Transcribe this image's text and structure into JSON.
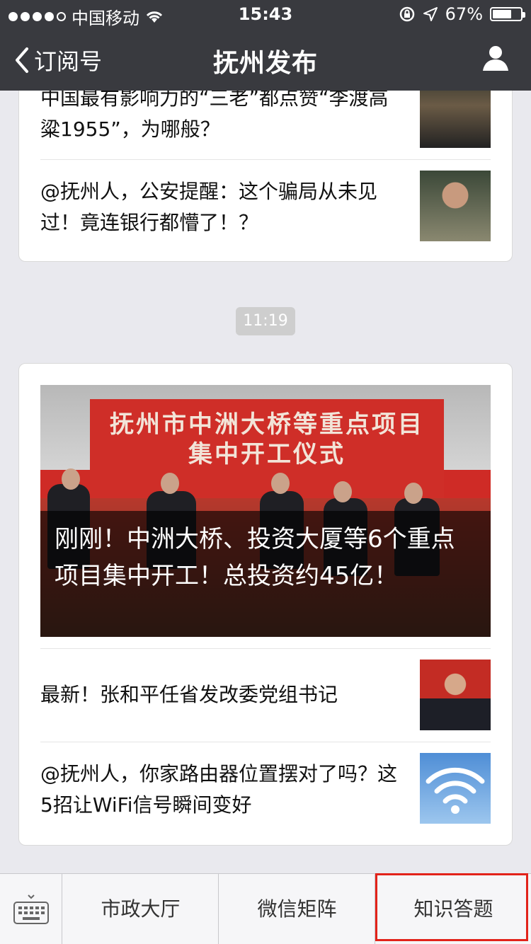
{
  "status_bar": {
    "carrier": "中国移动",
    "time": "15:43",
    "battery": "67%",
    "battery_level": 0.67
  },
  "nav": {
    "back_label": "订阅号",
    "title": "抚州发布"
  },
  "card1": {
    "items": [
      {
        "title": "中国最有影响力的“三老”都点赞“李渡高粱1955”，为哪般？"
      },
      {
        "title": "@抚州人，公安提醒：这个骗局从未见过！竟连银行都懵了！？"
      }
    ]
  },
  "timestamp": "11:19",
  "card2": {
    "hero": {
      "banner_line1": "抚州市中洲大桥等重点项目",
      "banner_line2": "集中开工仪式",
      "title": "刚刚！中洲大桥、投资大厦等6个重点项目集中开工！总投资约45亿！"
    },
    "items": [
      {
        "title": "最新！张和平任省发改委党组书记"
      },
      {
        "title": "@抚州人，你家路由器位置摆对了吗？这5招让WiFi信号瞬间变好"
      }
    ]
  },
  "bottom_menu": {
    "items": [
      "市政大厅",
      "微信矩阵",
      "知识答题"
    ]
  },
  "icons": [
    "wifi-icon",
    "lock-rotation-icon",
    "location-arrow-icon",
    "battery-icon",
    "back-chevron-icon",
    "person-icon",
    "keyboard-icon"
  ],
  "colors": {
    "nav_bg": "#393a3f",
    "highlight": "#e2231a",
    "page_bg": "#e9e9ee"
  }
}
